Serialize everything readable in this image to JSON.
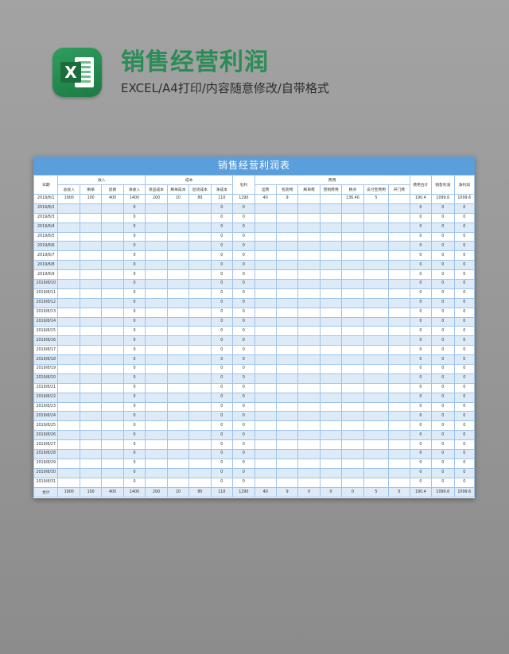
{
  "header": {
    "title": "销售经营利润",
    "subtitle": "EXCEL/A4打印/内容随意修改/自带格式",
    "logo_letter": "X",
    "logo_icon": "excel-icon",
    "title_color": "#2a8c57"
  },
  "sheet": {
    "title": "销售经营利润表",
    "title_bg": "#5a9fdc",
    "row_stripe": "#ddeaf8",
    "group_headers": {
      "date": "日期",
      "income": "收入",
      "cost": "成本",
      "gross": "毛利",
      "expense": "费用",
      "expense_total": "费用合计",
      "sales_profit": "销售利润",
      "net_profit": "净利润"
    },
    "sub_headers": {
      "income": [
        "总收入",
        "刷单",
        "退款",
        "净收入"
      ],
      "cost": [
        "货品成本",
        "刷单成本",
        "退货成本",
        "净成本"
      ],
      "expense": [
        "运费",
        "包装物",
        "刷单费",
        "营销费用",
        "税点",
        "支付宝费用",
        "开门费"
      ]
    },
    "rows": [
      [
        "2019/8/1",
        "1900",
        "100",
        "400",
        "1400",
        "200",
        "10",
        "80",
        "110",
        "1290",
        "40",
        "9",
        "",
        "",
        "136.40",
        "5",
        "",
        "190.4",
        "1099.6",
        "1099.6"
      ],
      [
        "2019/8/2",
        "",
        "",
        "",
        "0",
        "",
        "",
        "",
        "0",
        "0",
        "",
        "",
        "",
        "",
        "",
        "",
        "",
        "0",
        "0",
        "0"
      ],
      [
        "2019/8/3",
        "",
        "",
        "",
        "0",
        "",
        "",
        "",
        "0",
        "0",
        "",
        "",
        "",
        "",
        "",
        "",
        "",
        "0",
        "0",
        "0"
      ],
      [
        "2019/8/4",
        "",
        "",
        "",
        "0",
        "",
        "",
        "",
        "0",
        "0",
        "",
        "",
        "",
        "",
        "",
        "",
        "",
        "0",
        "0",
        "0"
      ],
      [
        "2019/8/5",
        "",
        "",
        "",
        "0",
        "",
        "",
        "",
        "0",
        "0",
        "",
        "",
        "",
        "",
        "",
        "",
        "",
        "0",
        "0",
        "0"
      ],
      [
        "2019/8/6",
        "",
        "",
        "",
        "0",
        "",
        "",
        "",
        "0",
        "0",
        "",
        "",
        "",
        "",
        "",
        "",
        "",
        "0",
        "0",
        "0"
      ],
      [
        "2019/8/7",
        "",
        "",
        "",
        "0",
        "",
        "",
        "",
        "0",
        "0",
        "",
        "",
        "",
        "",
        "",
        "",
        "",
        "0",
        "0",
        "0"
      ],
      [
        "2019/8/8",
        "",
        "",
        "",
        "0",
        "",
        "",
        "",
        "0",
        "0",
        "",
        "",
        "",
        "",
        "",
        "",
        "",
        "0",
        "0",
        "0"
      ],
      [
        "2019/8/9",
        "",
        "",
        "",
        "0",
        "",
        "",
        "",
        "0",
        "0",
        "",
        "",
        "",
        "",
        "",
        "",
        "",
        "0",
        "0",
        "0"
      ],
      [
        "2019/8/10",
        "",
        "",
        "",
        "0",
        "",
        "",
        "",
        "0",
        "0",
        "",
        "",
        "",
        "",
        "",
        "",
        "",
        "0",
        "0",
        "0"
      ],
      [
        "2019/8/11",
        "",
        "",
        "",
        "0",
        "",
        "",
        "",
        "0",
        "0",
        "",
        "",
        "",
        "",
        "",
        "",
        "",
        "0",
        "0",
        "0"
      ],
      [
        "2019/8/12",
        "",
        "",
        "",
        "0",
        "",
        "",
        "",
        "0",
        "0",
        "",
        "",
        "",
        "",
        "",
        "",
        "",
        "0",
        "0",
        "0"
      ],
      [
        "2019/8/13",
        "",
        "",
        "",
        "0",
        "",
        "",
        "",
        "0",
        "0",
        "",
        "",
        "",
        "",
        "",
        "",
        "",
        "0",
        "0",
        "0"
      ],
      [
        "2019/8/14",
        "",
        "",
        "",
        "0",
        "",
        "",
        "",
        "0",
        "0",
        "",
        "",
        "",
        "",
        "",
        "",
        "",
        "0",
        "0",
        "0"
      ],
      [
        "2019/8/15",
        "",
        "",
        "",
        "0",
        "",
        "",
        "",
        "0",
        "0",
        "",
        "",
        "",
        "",
        "",
        "",
        "",
        "0",
        "0",
        "0"
      ],
      [
        "2019/8/16",
        "",
        "",
        "",
        "0",
        "",
        "",
        "",
        "0",
        "0",
        "",
        "",
        "",
        "",
        "",
        "",
        "",
        "0",
        "0",
        "0"
      ],
      [
        "2019/8/17",
        "",
        "",
        "",
        "0",
        "",
        "",
        "",
        "0",
        "0",
        "",
        "",
        "",
        "",
        "",
        "",
        "",
        "0",
        "0",
        "0"
      ],
      [
        "2019/8/18",
        "",
        "",
        "",
        "0",
        "",
        "",
        "",
        "0",
        "0",
        "",
        "",
        "",
        "",
        "",
        "",
        "",
        "0",
        "0",
        "0"
      ],
      [
        "2019/8/19",
        "",
        "",
        "",
        "0",
        "",
        "",
        "",
        "0",
        "0",
        "",
        "",
        "",
        "",
        "",
        "",
        "",
        "0",
        "0",
        "0"
      ],
      [
        "2019/8/20",
        "",
        "",
        "",
        "0",
        "",
        "",
        "",
        "0",
        "0",
        "",
        "",
        "",
        "",
        "",
        "",
        "",
        "0",
        "0",
        "0"
      ],
      [
        "2019/8/21",
        "",
        "",
        "",
        "0",
        "",
        "",
        "",
        "0",
        "0",
        "",
        "",
        "",
        "",
        "",
        "",
        "",
        "0",
        "0",
        "0"
      ],
      [
        "2019/8/22",
        "",
        "",
        "",
        "0",
        "",
        "",
        "",
        "0",
        "0",
        "",
        "",
        "",
        "",
        "",
        "",
        "",
        "0",
        "0",
        "0"
      ],
      [
        "2019/8/23",
        "",
        "",
        "",
        "0",
        "",
        "",
        "",
        "0",
        "0",
        "",
        "",
        "",
        "",
        "",
        "",
        "",
        "0",
        "0",
        "0"
      ],
      [
        "2019/8/24",
        "",
        "",
        "",
        "0",
        "",
        "",
        "",
        "0",
        "0",
        "",
        "",
        "",
        "",
        "",
        "",
        "",
        "0",
        "0",
        "0"
      ],
      [
        "2019/8/25",
        "",
        "",
        "",
        "0",
        "",
        "",
        "",
        "0",
        "0",
        "",
        "",
        "",
        "",
        "",
        "",
        "",
        "0",
        "0",
        "0"
      ],
      [
        "2019/8/26",
        "",
        "",
        "",
        "0",
        "",
        "",
        "",
        "0",
        "0",
        "",
        "",
        "",
        "",
        "",
        "",
        "",
        "0",
        "0",
        "0"
      ],
      [
        "2019/8/27",
        "",
        "",
        "",
        "0",
        "",
        "",
        "",
        "0",
        "0",
        "",
        "",
        "",
        "",
        "",
        "",
        "",
        "0",
        "0",
        "0"
      ],
      [
        "2019/8/28",
        "",
        "",
        "",
        "0",
        "",
        "",
        "",
        "0",
        "0",
        "",
        "",
        "",
        "",
        "",
        "",
        "",
        "0",
        "0",
        "0"
      ],
      [
        "2019/8/29",
        "",
        "",
        "",
        "0",
        "",
        "",
        "",
        "0",
        "0",
        "",
        "",
        "",
        "",
        "",
        "",
        "",
        "0",
        "0",
        "0"
      ],
      [
        "2019/8/30",
        "",
        "",
        "",
        "0",
        "",
        "",
        "",
        "0",
        "0",
        "",
        "",
        "",
        "",
        "",
        "",
        "",
        "0",
        "0",
        "0"
      ],
      [
        "2019/8/31",
        "",
        "",
        "",
        "0",
        "",
        "",
        "",
        "0",
        "0",
        "",
        "",
        "",
        "",
        "",
        "",
        "",
        "0",
        "0",
        "0"
      ]
    ],
    "total_row": [
      "合计",
      "1900",
      "100",
      "400",
      "1400",
      "200",
      "10",
      "80",
      "110",
      "1290",
      "40",
      "9",
      "0",
      "0",
      "0",
      "5",
      "0",
      "190.4",
      "1099.6",
      "1099.6"
    ]
  }
}
